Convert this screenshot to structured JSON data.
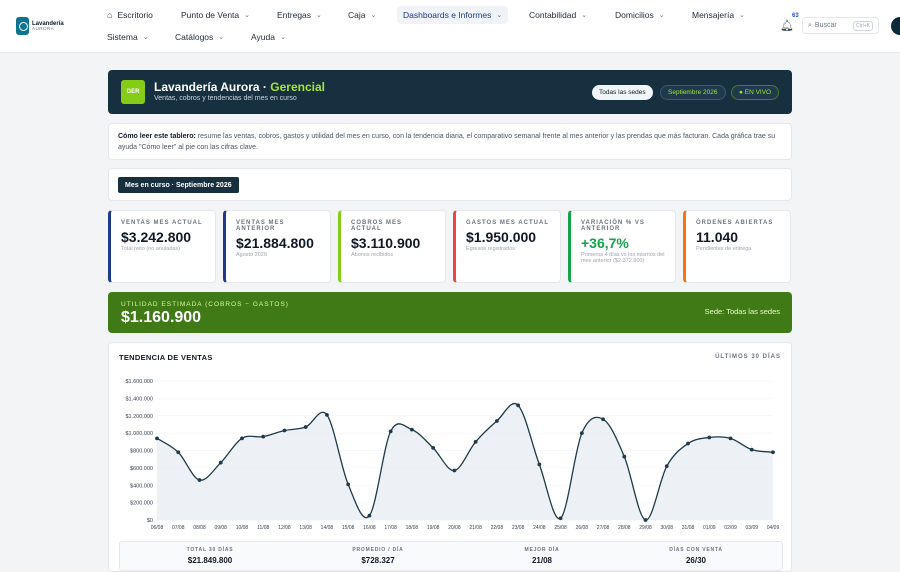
{
  "app": {
    "name": "Lavandería",
    "subname": "AURORA"
  },
  "nav": {
    "row1": [
      {
        "label": "Escritorio",
        "icon": "home-icon"
      },
      {
        "label": "Punto de Venta"
      },
      {
        "label": "Entregas"
      },
      {
        "label": "Caja"
      },
      {
        "label": "Dashboards e Informes",
        "active": true
      },
      {
        "label": "Contabilidad"
      },
      {
        "label": "Domicilios"
      },
      {
        "label": "Mensajería"
      }
    ],
    "row2": [
      {
        "label": "Sistema"
      },
      {
        "label": "Catálogos"
      },
      {
        "label": "Ayuda"
      }
    ],
    "notifications": "63",
    "search_label": "Buscar",
    "search_shortcut": "Ctrl+K"
  },
  "hero": {
    "badge": "GER",
    "title_prefix": "Lavandería Aurora · ",
    "title_accent": "Gerencial",
    "subtitle": "Ventas, cobros y tendencias del mes en curso",
    "pill_sede": "Todas las sedes",
    "pill_month": "Septiembre 2026",
    "pill_live": "● EN VIVO"
  },
  "help": {
    "lead": "Cómo leer este tablero:",
    "text": " resume las ventas, cobros, gastos y utilidad del mes en curso, con la tendencia diaria, el comparativo semanal frente al mes anterior y las prendas que más facturan. Cada gráfica trae su ayuda \"Cómo leer\" al pie con las cifras clave."
  },
  "filter": {
    "chip": "Mes en curso · Septiembre 2026"
  },
  "kpis": [
    {
      "label": "Ventas mes actual",
      "value": "$3.242.800",
      "sub": "Total neto (no anuladas)",
      "color": "#1e3a8a"
    },
    {
      "label": "Ventas mes anterior",
      "value": "$21.884.800",
      "sub": "Agosto 2026",
      "color": "#1e3a8a"
    },
    {
      "label": "Cobros mes actual",
      "value": "$3.110.900",
      "sub": "Abonos recibidos",
      "color": "#84cc16"
    },
    {
      "label": "Gastos mes actual",
      "value": "$1.950.000",
      "sub": "Egresos registrados",
      "color": "#ef4444"
    },
    {
      "label": "Variación % vs anterior",
      "value": "+36,7%",
      "sub": "Primeros 4 días vs los mismos del mes anterior ($2.372.900)",
      "color": "#16a34a"
    },
    {
      "label": "Órdenes abiertas",
      "value": "11.040",
      "sub": "Pendientes de entrega",
      "color": "#f97316"
    }
  ],
  "profit": {
    "label": "UTILIDAD ESTIMADA (COBROS − GASTOS)",
    "value": "$1.160.900",
    "sede": "Sede: Todas las sedes"
  },
  "trend": {
    "title": "TENDENCIA DE VENTAS",
    "range": "ÚLTIMOS 30 DÍAS",
    "summary": [
      {
        "label": "TOTAL 30 DÍAS",
        "value": "$21.849.800"
      },
      {
        "label": "PROMEDIO / DÍA",
        "value": "$728.327"
      },
      {
        "label": "MEJOR DÍA",
        "value": "21/08"
      },
      {
        "label": "DÍAS CON VENTA",
        "value": "26/30"
      }
    ]
  },
  "chart_data": {
    "type": "line",
    "title": "TENDENCIA DE VENTAS",
    "xlabel": "",
    "ylabel": "",
    "ylim": [
      0,
      1600000
    ],
    "yticks": [
      "$0",
      "$200.000",
      "$400.000",
      "$600.000",
      "$800.000",
      "$1.000.000",
      "$1.200.000",
      "$1.400.000",
      "$1.600.000"
    ],
    "x": [
      "06/08",
      "07/08",
      "08/08",
      "09/08",
      "10/08",
      "11/08",
      "12/08",
      "13/08",
      "14/08",
      "15/08",
      "16/08",
      "17/08",
      "18/08",
      "19/08",
      "20/08",
      "21/08",
      "22/08",
      "23/08",
      "24/08",
      "25/08",
      "26/08",
      "27/08",
      "28/08",
      "29/08",
      "30/08",
      "31/08",
      "01/09",
      "02/09",
      "03/09",
      "04/09"
    ],
    "series": [
      {
        "color": "#1e3a4c",
        "values": [
          940000,
          780000,
          460000,
          660000,
          940000,
          960000,
          1030000,
          1070000,
          1210000,
          410000,
          50000,
          1020000,
          1040000,
          830000,
          570000,
          900000,
          1140000,
          1320000,
          640000,
          20000,
          1000000,
          1160000,
          730000,
          0,
          620000,
          880000,
          950000,
          940000,
          810000,
          780000
        ]
      }
    ],
    "grid": true,
    "legend": "none"
  }
}
